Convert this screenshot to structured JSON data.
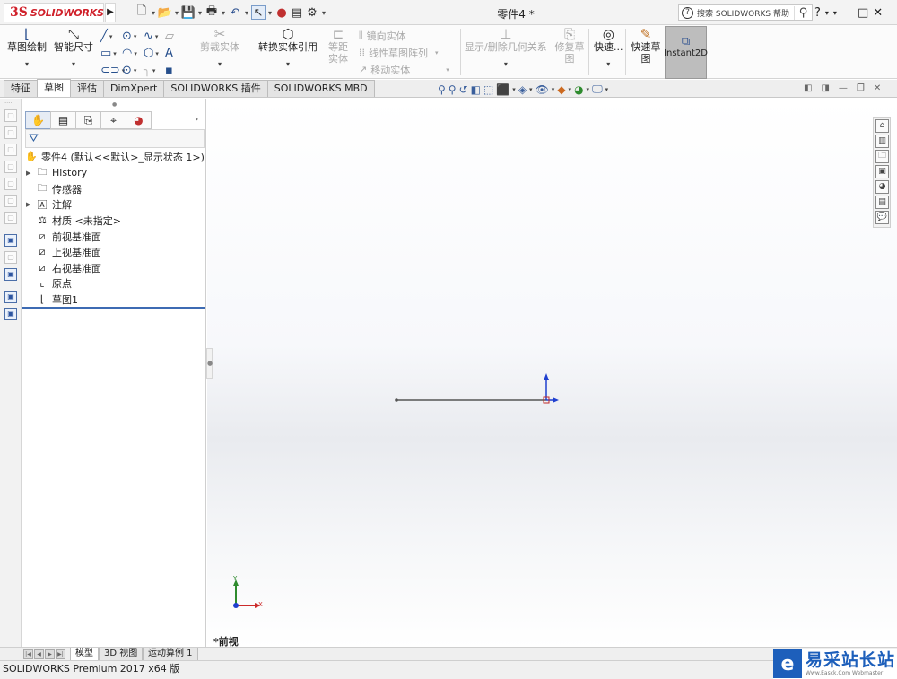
{
  "app": {
    "logo_mark": "3S",
    "logo_text": "SOLIDWORKS",
    "document_title": "零件4 *"
  },
  "quick_access": {
    "icons": [
      "new-file-icon",
      "open-file-icon",
      "save-icon",
      "print-icon",
      "undo-icon",
      "select-arrow-icon",
      "rebuild-icon",
      "file-properties-icon",
      "options-gear-icon"
    ]
  },
  "help_search": {
    "placeholder": "搜索 SOLIDWORKS 帮助"
  },
  "window_controls": {
    "help": "?",
    "minimize": "—",
    "maximize": "□",
    "close": "✕"
  },
  "command_manager": {
    "sketch": "草图绘制",
    "smart_dimension": "智能尺寸",
    "trim_entities": "剪裁实体",
    "convert_entities": "转换实体引用",
    "offset_entities": "等距实体",
    "mirror_entities": "镜向实体",
    "linear_pattern": "线性草图阵列",
    "move_entities": "移动实体",
    "display_relations": "显示/删除几何关系",
    "repair_sketch": "修复草图",
    "quick_snaps": "快速...",
    "rapid_sketch": "快速草图",
    "instant2d": "Instant2D"
  },
  "tabs": [
    {
      "label": "特征",
      "active": false
    },
    {
      "label": "草图",
      "active": true
    },
    {
      "label": "评估",
      "active": false
    },
    {
      "label": "DimXpert",
      "active": false
    },
    {
      "label": "SOLIDWORKS 插件",
      "active": false
    },
    {
      "label": "SOLIDWORKS MBD",
      "active": false
    }
  ],
  "feature_tree": {
    "root": "零件4 (默认<<默认>_显示状态 1>)",
    "items": [
      {
        "label": "History",
        "expandable": true,
        "icon": "history-folder-icon"
      },
      {
        "label": "传感器",
        "expandable": false,
        "icon": "sensor-folder-icon"
      },
      {
        "label": "注解",
        "expandable": true,
        "icon": "annotation-folder-icon"
      },
      {
        "label": "材质 <未指定>",
        "expandable": false,
        "icon": "material-icon"
      },
      {
        "label": "前视基准面",
        "expandable": false,
        "icon": "plane-icon"
      },
      {
        "label": "上视基准面",
        "expandable": false,
        "icon": "plane-icon"
      },
      {
        "label": "右视基准面",
        "expandable": false,
        "icon": "plane-icon"
      },
      {
        "label": "原点",
        "expandable": false,
        "icon": "origin-icon"
      },
      {
        "label": "草图1",
        "expandable": false,
        "icon": "sketch-icon"
      }
    ]
  },
  "graphics": {
    "view_name": "*前视",
    "triad_x": "X",
    "triad_y": "Y"
  },
  "bottom_tabs": [
    {
      "label": "模型",
      "active": true
    },
    {
      "label": "3D 视图",
      "active": false
    },
    {
      "label": "运动算例 1",
      "active": false
    }
  ],
  "status_bar": {
    "text": "SOLIDWORKS Premium 2017 x64 版"
  },
  "watermark": {
    "logo": "e",
    "cn": "易采站长站",
    "en": "Www.Easck.Com Webmaster"
  },
  "colors": {
    "brand_red": "#d0202a",
    "selection_blue": "#3d6bb3",
    "sketch_line": "#555555",
    "axis_blue": "#1f3fcf",
    "axis_green": "#2e8b2e",
    "axis_red": "#cc2b2b"
  }
}
